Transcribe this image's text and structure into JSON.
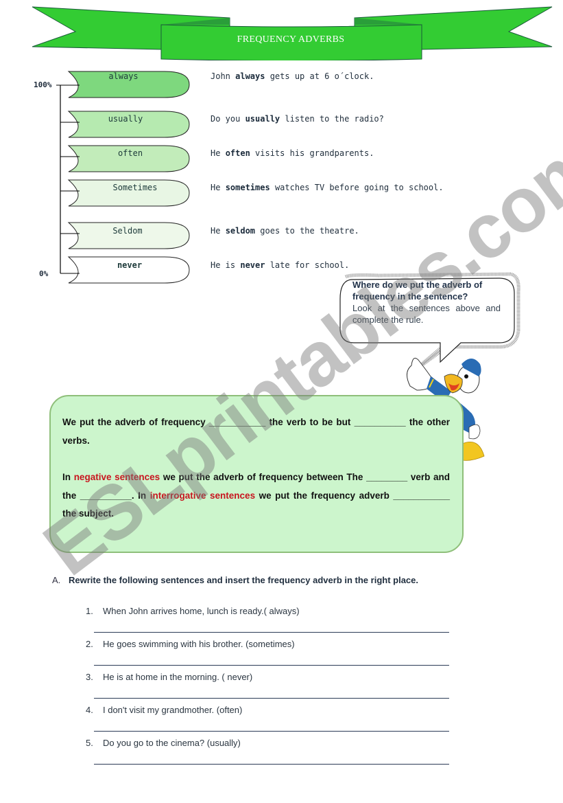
{
  "header": {
    "title": "FREQUENCY ADVERBS",
    "banner_color": "#33cc33"
  },
  "scale": {
    "top_label": "100%",
    "bottom_label": "0%"
  },
  "adverbs": [
    {
      "label": "always",
      "fill": "#7ed87e",
      "sentence": {
        "before": "John ",
        "adverb": "always",
        "after": " gets up at 6 o´clock."
      }
    },
    {
      "label": "usually",
      "fill": "#b6eab0",
      "sentence": {
        "before": "Do you ",
        "adverb": "usually",
        "after": " listen to the radio?"
      }
    },
    {
      "label": "often",
      "fill": "#c2ecba",
      "sentence": {
        "before": "He ",
        "adverb": "often",
        "after": " visits his grandparents."
      }
    },
    {
      "label": "Sometimes",
      "fill": "#e8f6e4",
      "sentence": {
        "before": "He ",
        "adverb": "sometimes",
        "after": " watches TV before going to school."
      }
    },
    {
      "label": "Seldom",
      "fill": "#eef8ea",
      "sentence": {
        "before": "He ",
        "adverb": "seldom",
        "after": " goes to the theatre."
      }
    },
    {
      "label": "never",
      "fill": "#ffffff",
      "sentence": {
        "before": "He is ",
        "adverb": "never",
        "after": " late for school."
      }
    }
  ],
  "speech_bubble": {
    "question": "Where do we put the adverb of frequency in the sentence?",
    "instruction": "Look at the sentences above and complete the rule."
  },
  "rule_box": {
    "paragraph1": {
      "text1": "We put the adverb of frequency  ___________ the verb to be but __________ the other verbs."
    },
    "paragraph2": {
      "part1": "In ",
      "red1": "negative sentences",
      "part2": " we put the adverb of frequency between The ________ verb and the __________. In ",
      "red2": "interrogative sentences",
      "part3": " we  put the frequency adverb ___________ the subject."
    },
    "highlight_color": "#c8141e",
    "background": "#ccf5cc"
  },
  "exercise": {
    "letter": "A.",
    "title": "Rewrite the following sentences and insert the frequency adverb in the right place.",
    "items": [
      {
        "num": "1.",
        "text": "When John arrives home, lunch is ready.( always)"
      },
      {
        "num": "2.",
        "text": "He goes swimming with his brother. (sometimes)"
      },
      {
        "num": "3.",
        "text": "He is at home in the morning. ( never)"
      },
      {
        "num": "4.",
        "text": "I don't visit my grandmother. (often)"
      },
      {
        "num": "5.",
        "text": "Do you go to the cinema? (usually)"
      }
    ]
  },
  "watermark": "ESLprintables.com"
}
